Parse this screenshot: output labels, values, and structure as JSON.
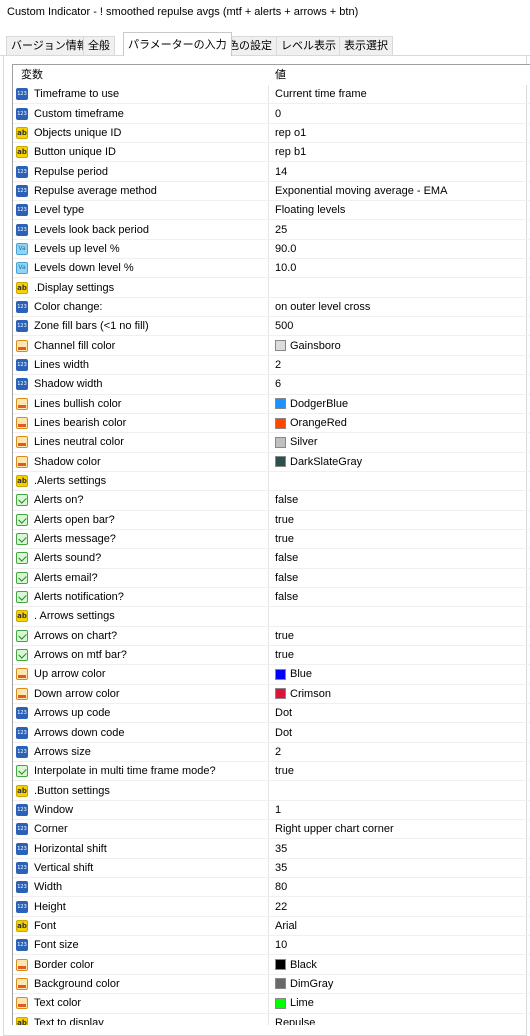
{
  "window": {
    "title": "Custom Indicator - ! smoothed repulse avgs (mtf + alerts + arrows + btn)"
  },
  "tabs": [
    {
      "label": "バージョン情報"
    },
    {
      "label": "全般"
    },
    {
      "label": "パラメーターの入力"
    },
    {
      "label": "色の設定"
    },
    {
      "label": "レベル表示"
    },
    {
      "label": "表示選択"
    }
  ],
  "active_tab": "パラメーターの入力",
  "grid": {
    "header": {
      "variable": "変数",
      "value": "値"
    },
    "rows": [
      {
        "icon": "int",
        "name": "Timeframe to use",
        "value": "Current time frame"
      },
      {
        "icon": "int",
        "name": "Custom timeframe",
        "value": "0"
      },
      {
        "icon": "str",
        "name": "Objects unique ID",
        "value": "rep o1"
      },
      {
        "icon": "str",
        "name": "Button unique ID",
        "value": "rep b1"
      },
      {
        "icon": "int",
        "name": "Repulse period",
        "value": "14"
      },
      {
        "icon": "int",
        "name": "Repulse average method",
        "value": "Exponential moving average - EMA"
      },
      {
        "icon": "int",
        "name": "Level type",
        "value": "Floating levels"
      },
      {
        "icon": "int",
        "name": "Levels look back period",
        "value": "25"
      },
      {
        "icon": "dbl",
        "name": "Levels up level %",
        "value": "90.0"
      },
      {
        "icon": "dbl",
        "name": "Levels down level %",
        "value": "10.0"
      },
      {
        "icon": "str",
        "name": ".Display settings",
        "value": ""
      },
      {
        "icon": "int",
        "name": "Color change:",
        "value": "on outer level cross"
      },
      {
        "icon": "int",
        "name": "Zone fill bars (<1 no fill)",
        "value": "500"
      },
      {
        "icon": "color",
        "name": "Channel fill color",
        "value": "Gainsboro",
        "swatch": "#dcdcdc"
      },
      {
        "icon": "int",
        "name": "Lines width",
        "value": "2"
      },
      {
        "icon": "int",
        "name": "Shadow width",
        "value": "6"
      },
      {
        "icon": "color",
        "name": "Lines bullish color",
        "value": "DodgerBlue",
        "swatch": "#1e90ff"
      },
      {
        "icon": "color",
        "name": "Lines bearish color",
        "value": "OrangeRed",
        "swatch": "#ff4500"
      },
      {
        "icon": "color",
        "name": "Lines neutral color",
        "value": "Silver",
        "swatch": "#c0c0c0"
      },
      {
        "icon": "color",
        "name": "Shadow color",
        "value": "DarkSlateGray",
        "swatch": "#2f4f4f"
      },
      {
        "icon": "str",
        "name": ".Alerts settings",
        "value": ""
      },
      {
        "icon": "bool",
        "name": "Alerts on?",
        "value": "false"
      },
      {
        "icon": "bool",
        "name": "Alerts open bar?",
        "value": "true"
      },
      {
        "icon": "bool",
        "name": "Alerts message?",
        "value": "true"
      },
      {
        "icon": "bool",
        "name": "Alerts sound?",
        "value": "false"
      },
      {
        "icon": "bool",
        "name": "Alerts email?",
        "value": "false"
      },
      {
        "icon": "bool",
        "name": "Alerts notification?",
        "value": "false"
      },
      {
        "icon": "str",
        "name": ". Arrows settings",
        "value": ""
      },
      {
        "icon": "bool",
        "name": "Arrows on chart?",
        "value": "true"
      },
      {
        "icon": "bool",
        "name": "Arrows on mtf bar?",
        "value": "true"
      },
      {
        "icon": "color",
        "name": "Up arrow color",
        "value": "Blue",
        "swatch": "#0000ff"
      },
      {
        "icon": "color",
        "name": "Down arrow color",
        "value": "Crimson",
        "swatch": "#dc143c"
      },
      {
        "icon": "int",
        "name": "Arrows up code",
        "value": "Dot"
      },
      {
        "icon": "int",
        "name": "Arrows down code",
        "value": "Dot"
      },
      {
        "icon": "int",
        "name": "Arrows size",
        "value": "2"
      },
      {
        "icon": "bool",
        "name": "Interpolate in multi time frame mode?",
        "value": "true"
      },
      {
        "icon": "str",
        "name": ".Button settings",
        "value": ""
      },
      {
        "icon": "int",
        "name": "Window",
        "value": "1"
      },
      {
        "icon": "int",
        "name": "Corner",
        "value": "Right upper chart corner"
      },
      {
        "icon": "int",
        "name": "Horizontal shift",
        "value": "35"
      },
      {
        "icon": "int",
        "name": "Vertical shift",
        "value": "35"
      },
      {
        "icon": "int",
        "name": "Width",
        "value": "80"
      },
      {
        "icon": "int",
        "name": "Height",
        "value": "22"
      },
      {
        "icon": "str",
        "name": "Font",
        "value": "Arial"
      },
      {
        "icon": "int",
        "name": "Font size",
        "value": "10"
      },
      {
        "icon": "color",
        "name": "Border color",
        "value": "Black",
        "swatch": "#000000"
      },
      {
        "icon": "color",
        "name": "Background color",
        "value": "DimGray",
        "swatch": "#696969"
      },
      {
        "icon": "color",
        "name": "Text color",
        "value": "Lime",
        "swatch": "#00ff00"
      },
      {
        "icon": "str",
        "name": "Text to display",
        "value": "Repulse"
      }
    ]
  }
}
